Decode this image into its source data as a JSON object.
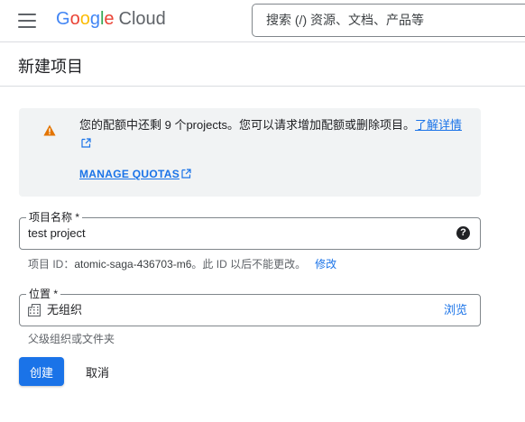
{
  "header": {
    "logo": {
      "g1": "G",
      "o1": "o",
      "o2": "o",
      "g2": "g",
      "l": "l",
      "e": "e",
      "product": "Cloud"
    },
    "search_placeholder": "搜索 (/) 资源、文档、产品等"
  },
  "page": {
    "title": "新建项目"
  },
  "notice": {
    "message": "您的配额中还剩 9 个projects。您可以请求增加配额或删除项目。",
    "learn_more": "了解详情",
    "manage_quotas": "MANAGE QUOTAS",
    "icon": "warning-icon"
  },
  "project_name": {
    "label": "项目名称 *",
    "value": "test project",
    "help": "?"
  },
  "project_id": {
    "prefix": "项目 ID：",
    "value": "atomic-saga-436703-m6",
    "suffix": "。此 ID 以后不能更改。",
    "edit": "修改"
  },
  "location": {
    "label": "位置 *",
    "value": "无组织",
    "browse": "浏览",
    "hint": "父级组织或文件夹",
    "icon": "organization-icon"
  },
  "actions": {
    "create": "创建",
    "cancel": "取消"
  },
  "colors": {
    "accent": "#1a73e8",
    "warning": "#e37400",
    "notice_bg": "#f1f3f4"
  }
}
